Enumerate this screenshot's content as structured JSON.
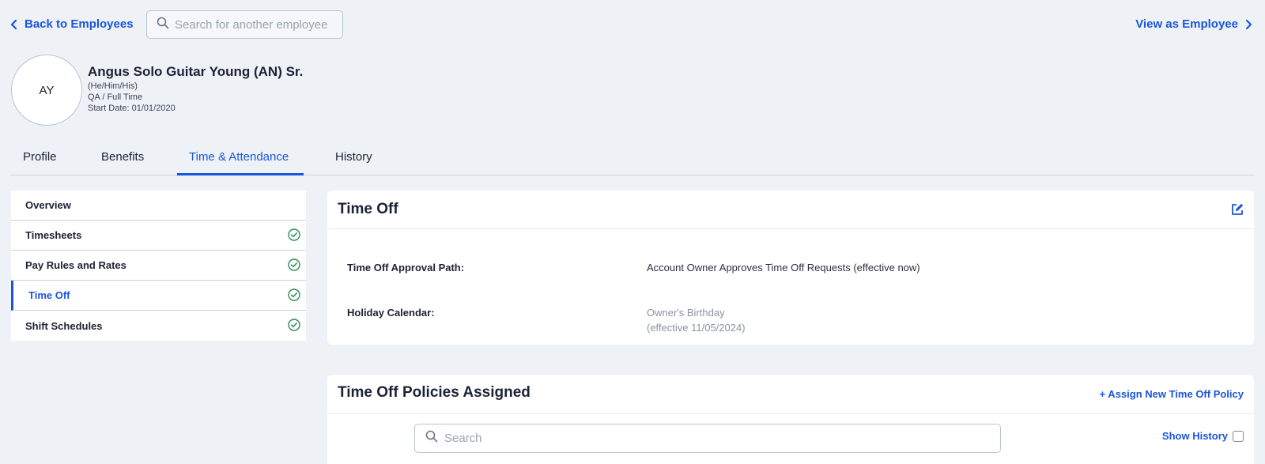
{
  "nav": {
    "back_label": "Back to Employees",
    "search_placeholder": "Search for another employee",
    "view_as_label": "View as Employee"
  },
  "employee": {
    "initials": "AY",
    "name": "Angus Solo Guitar Young (AN) Sr.",
    "pronouns": "(He/Him/His)",
    "role": "QA / Full Time",
    "start_date": "Start Date: 01/01/2020"
  },
  "tabs": [
    {
      "label": "Profile",
      "active": false
    },
    {
      "label": "Benefits",
      "active": false
    },
    {
      "label": "Time & Attendance",
      "active": true
    },
    {
      "label": "History",
      "active": false
    }
  ],
  "sidebar": {
    "items": [
      {
        "label": "Overview",
        "checked": false,
        "active": false
      },
      {
        "label": "Timesheets",
        "checked": true,
        "active": false
      },
      {
        "label": "Pay Rules and Rates",
        "checked": true,
        "active": false
      },
      {
        "label": "Time Off",
        "checked": true,
        "active": true
      },
      {
        "label": "Shift Schedules",
        "checked": true,
        "active": false
      }
    ]
  },
  "time_off": {
    "title": "Time Off",
    "approval_label": "Time Off Approval Path:",
    "approval_value": "Account Owner Approves Time Off Requests (effective now)",
    "holiday_label": "Holiday Calendar:",
    "holiday_value": "Owner's Birthday",
    "holiday_effective": "(effective 11/05/2024)"
  },
  "policies": {
    "title": "Time Off Policies Assigned",
    "assign_label": "+ Assign New Time Off Policy",
    "search_placeholder": "Search",
    "show_history_label": "Show History"
  },
  "colors": {
    "accent": "#1a56db",
    "background": "#eef2f7",
    "check_green": "#2e8b57"
  }
}
